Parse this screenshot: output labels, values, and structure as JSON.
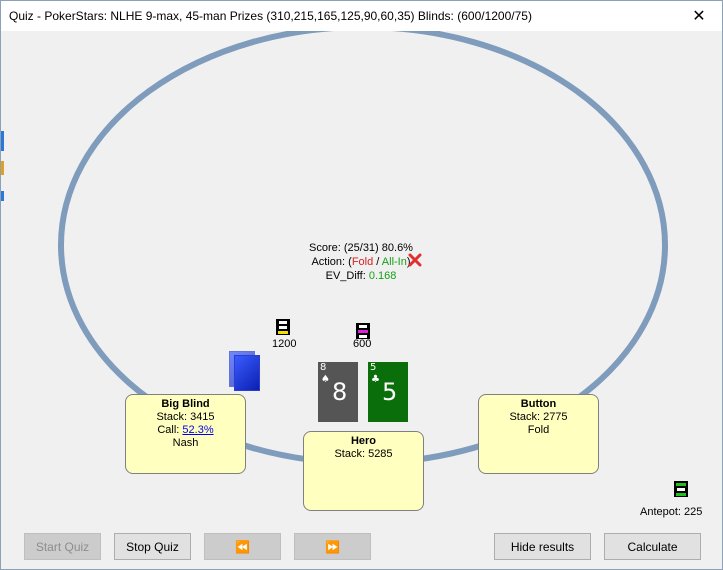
{
  "window": {
    "title": "Quiz - PokerStars: NLHE 9-max, 45-man Prizes (310,215,165,125,90,60,35) Blinds: (600/1200/75)",
    "close_glyph": "✕"
  },
  "info": {
    "score": "Score: (25/31) 80.6%",
    "action_prefix": "Action: (",
    "action_fold": "Fold",
    "action_sep": " / ",
    "action_allin": "All-In",
    "action_suffix": ")",
    "ev_prefix": "EV_Diff: ",
    "ev_value": "0.168"
  },
  "bets": {
    "big_blind_bet": "1200",
    "hero_bet": "600",
    "antepot": "Antepot: 225"
  },
  "cards": [
    {
      "rank": "8",
      "suit": "♠",
      "color": "#555555"
    },
    {
      "rank": "5",
      "suit": "♣",
      "color": "#0a6e0a"
    }
  ],
  "seats": {
    "big_blind": {
      "name": "Big Blind",
      "stack": "Stack: 3415",
      "call_prefix": "Call: ",
      "call_link": "52.3%",
      "note": "Nash"
    },
    "hero": {
      "name": "Hero",
      "stack": "Stack: 5285"
    },
    "button": {
      "name": "Button",
      "stack": "Stack: 2775",
      "action": "Fold"
    }
  },
  "buttons": {
    "start_quiz": "Start Quiz",
    "stop_quiz": "Stop Quiz",
    "prev": "⏪",
    "next": "⏩",
    "hide_results": "Hide results",
    "calculate": "Calculate"
  },
  "colors": {
    "table_rim": "#7f9cbd",
    "seat_fill": "#ffffc0",
    "deck_blue": "#1a2fe0",
    "fold_red": "#d42020",
    "allin_green": "#18a018"
  }
}
